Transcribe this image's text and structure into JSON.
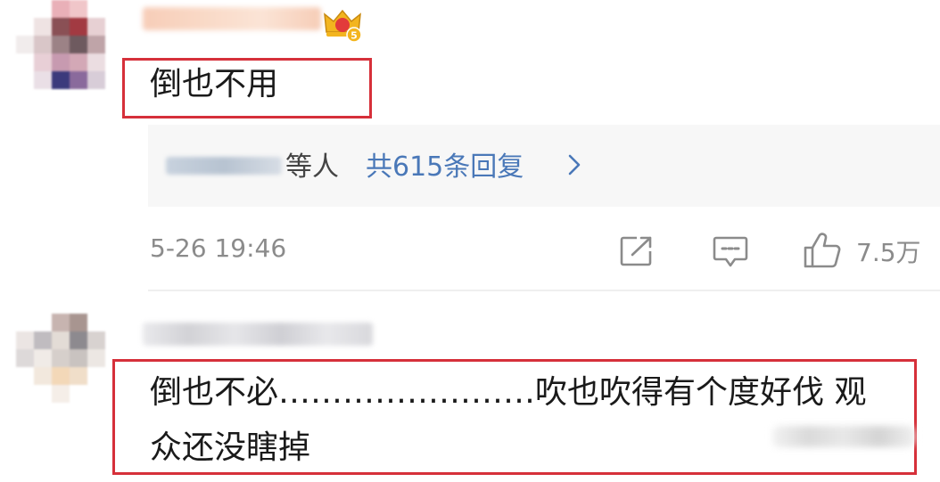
{
  "comments": [
    {
      "text": "倒也不用",
      "reply_summary": {
        "who_suffix": "等人",
        "link": "共615条回复"
      },
      "time": "5-26 19:46",
      "like_count": "7.5万",
      "icons": [
        "share-icon",
        "comment-icon",
        "thumbs-up-icon"
      ]
    },
    {
      "text_line1": "倒也不必……………………吹也吹得有个度好伐 观",
      "text_line2": "众还没瞎掉"
    }
  ],
  "colors": {
    "highlight_box": "#d6303a",
    "link": "#4a78b8",
    "meta": "#8b8b8b",
    "reply_panel_bg": "#f7f7f7"
  }
}
